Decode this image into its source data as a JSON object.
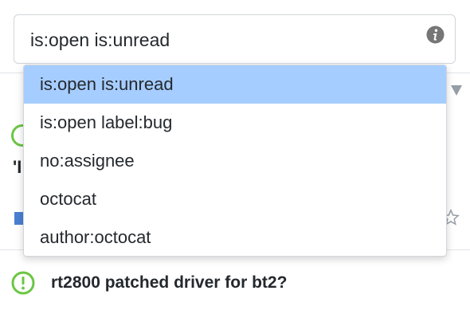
{
  "search": {
    "value": "is:open is:unread",
    "icon": "info-icon"
  },
  "dropdown": {
    "items": [
      {
        "label": "is:open is:unread",
        "selected": true
      },
      {
        "label": "is:open label:bug",
        "selected": false
      },
      {
        "label": "no:assignee",
        "selected": false
      },
      {
        "label": "octocat",
        "selected": false
      },
      {
        "label": "author:octocat",
        "selected": false
      }
    ]
  },
  "partial_issue": {
    "text_fragment": "'I"
  },
  "issue": {
    "title": "rt2800 patched driver for bt2?",
    "status_icon": "issue-opened-icon"
  },
  "colors": {
    "accent_highlight": "#a6cdff",
    "open_green": "#6cc644",
    "icon_gray": "#959da5"
  }
}
